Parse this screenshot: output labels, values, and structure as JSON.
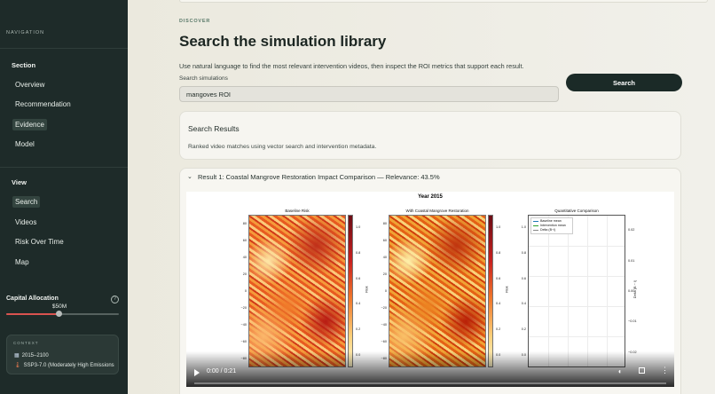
{
  "sidebar": {
    "nav_heading": "NAVIGATION",
    "section_label": "Section",
    "section_items": [
      {
        "label": "Overview",
        "active": false
      },
      {
        "label": "Recommendation",
        "active": false
      },
      {
        "label": "Evidence",
        "active": true
      },
      {
        "label": "Model",
        "active": false
      }
    ],
    "view_label": "View",
    "view_items": [
      {
        "label": "Search",
        "active": true
      },
      {
        "label": "Videos",
        "active": false
      },
      {
        "label": "Risk Over Time",
        "active": false
      },
      {
        "label": "Map",
        "active": false
      }
    ],
    "capital": {
      "label": "Capital Allocation",
      "value": "$50M",
      "slider_fraction": 0.47
    },
    "context": {
      "title": "CONTEXT",
      "period": "2015–2100",
      "scenario": "SSP3-7.0 (Moderately High Emissions"
    }
  },
  "main": {
    "eyebrow": "DISCOVER",
    "title": "Search the simulation library",
    "subtitle": "Use natural language to find the most relevant intervention videos, then inspect the ROI metrics that support each result.",
    "search": {
      "label": "Search simulations",
      "value": "mangoves ROI",
      "button": "Search"
    },
    "results": {
      "title": "Search Results",
      "description": "Ranked video matches using vector search and intervention metadata."
    },
    "result_1": {
      "title": "Result 1: Coastal Mangrove Restoration Impact Comparison — Relevance: 43.5%",
      "video": {
        "frame_title": "Year 2015",
        "panel_baseline": "Baseline Risk",
        "panel_intervention": "With Coastal Mangrove Restoration",
        "panel_comparison": "Quantitative Comparison",
        "lat_ticks": [
          "80",
          "60",
          "40",
          "20",
          "0",
          "−20",
          "−40",
          "−60",
          "−80"
        ],
        "cbar_ticks": [
          "1.0",
          "0.8",
          "0.6",
          "0.4",
          "0.2",
          "0.0"
        ],
        "cbar_label": "Risk",
        "cmp_left_ticks": [
          "1.0",
          "0.8",
          "0.6",
          "0.4",
          "0.2",
          "0.0"
        ],
        "cmp_right_ticks": [
          "0.02",
          "0.01",
          "0.00",
          "−0.01",
          "−0.02"
        ],
        "cmp_right_label": "Delta (B − I)",
        "legend": [
          "Baseline mean",
          "Intervention mean",
          "Delta (B−I)"
        ],
        "time": "0:00 / 0:21",
        "progress_fraction": 0.0
      }
    }
  },
  "colors": {
    "sidebar_bg": "#1e2b29",
    "accent_red": "#d9534f",
    "button_bg": "#1b2a27"
  }
}
